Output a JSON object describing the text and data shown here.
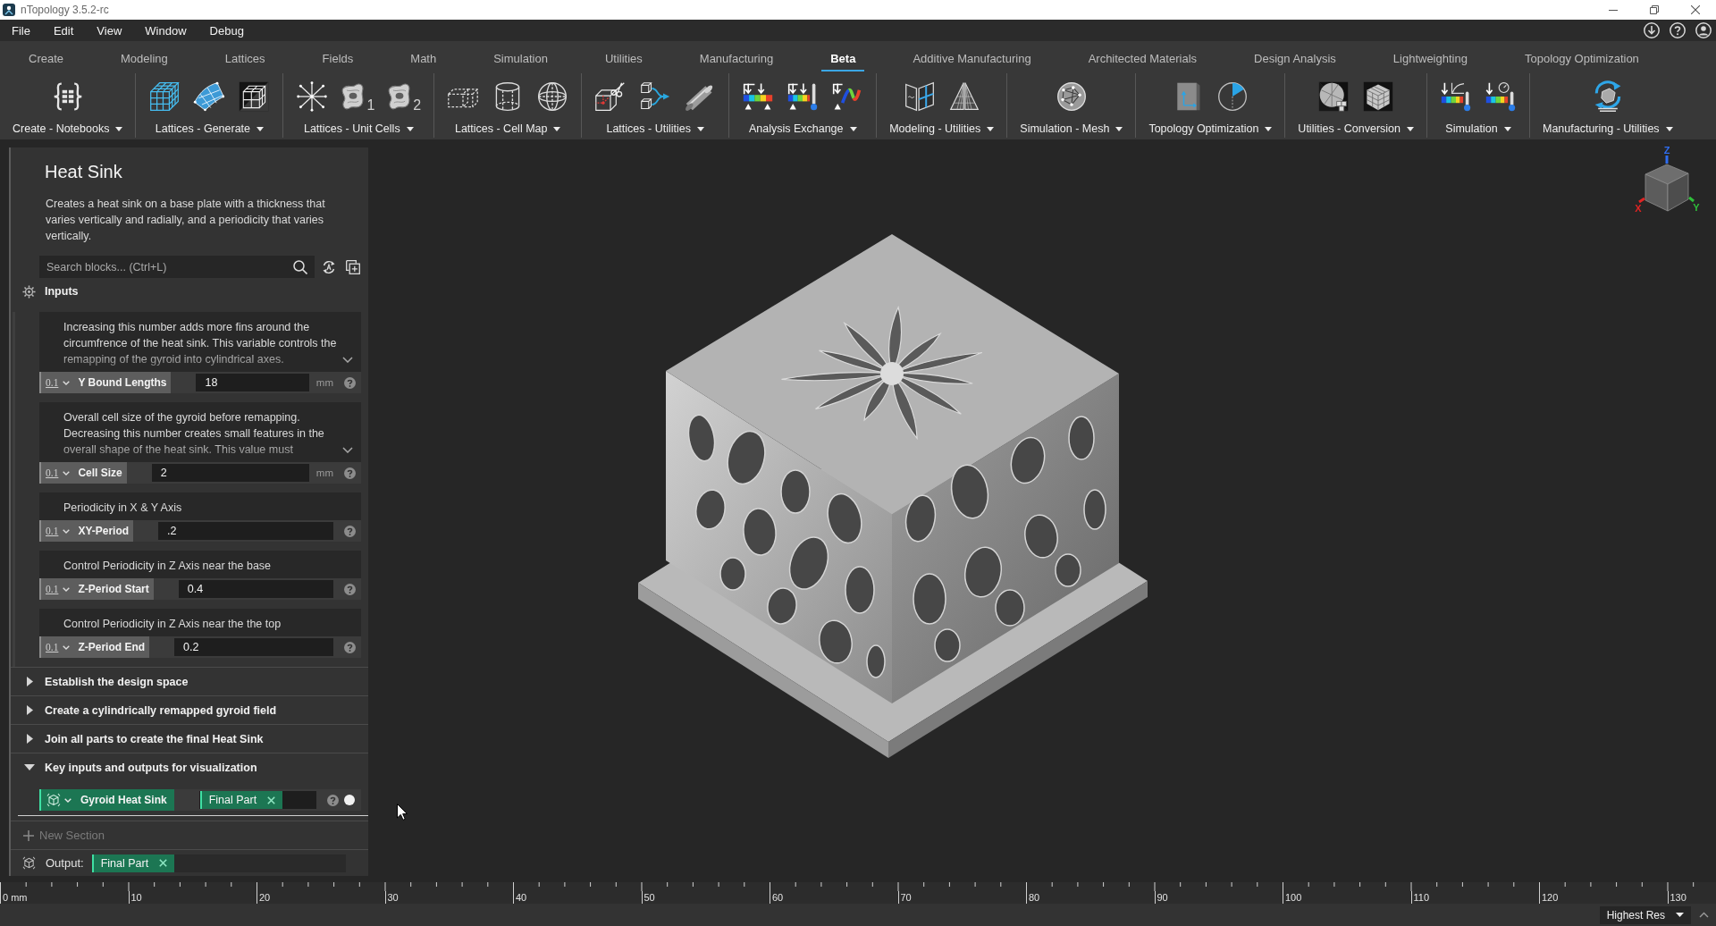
{
  "window": {
    "title": "nTopology 3.5.2-rc"
  },
  "menu": [
    "File",
    "Edit",
    "View",
    "Window",
    "Debug"
  ],
  "ribbon": {
    "tabs": [
      {
        "label": "Create",
        "selected": false
      },
      {
        "label": "Modeling",
        "selected": false
      },
      {
        "label": "Lattices",
        "selected": false
      },
      {
        "label": "Fields",
        "selected": false
      },
      {
        "label": "Math",
        "selected": false
      },
      {
        "label": "Simulation",
        "selected": false
      },
      {
        "label": "Utilities",
        "selected": false
      },
      {
        "label": "Manufacturing",
        "selected": false
      },
      {
        "label": "Beta",
        "selected": true
      },
      {
        "label": "Additive Manufacturing",
        "selected": false
      },
      {
        "label": "Architected Materials",
        "selected": false
      },
      {
        "label": "Design Analysis",
        "selected": false
      },
      {
        "label": "Lightweighting",
        "selected": false
      },
      {
        "label": "Topology Optimization",
        "selected": false
      }
    ],
    "groups": [
      {
        "label": "Create - Notebooks",
        "tools": [
          {
            "kind": "notebook"
          }
        ]
      },
      {
        "label": "Lattices - Generate",
        "tools": [
          {
            "kind": "grid-lattice"
          },
          {
            "kind": "surface-lattice"
          },
          {
            "kind": "volume-lattice"
          }
        ]
      },
      {
        "label": "Lattices - Unit Cells",
        "tools": [
          {
            "kind": "strut-cell"
          },
          {
            "kind": "gyroid-cell",
            "badge": "1"
          },
          {
            "kind": "gyroid-cell",
            "badge": "2"
          }
        ]
      },
      {
        "label": "Lattices - Cell Map",
        "tools": [
          {
            "kind": "box-map"
          },
          {
            "kind": "cylinder-map"
          },
          {
            "kind": "sphere-map"
          }
        ]
      },
      {
        "label": "Lattices - Utilities",
        "tools": [
          {
            "kind": "trim-cell"
          },
          {
            "kind": "merge-cells"
          },
          {
            "kind": "rod"
          }
        ]
      },
      {
        "label": "Analysis Exchange",
        "tools": [
          {
            "kind": "load-map"
          },
          {
            "kind": "thermal-load"
          },
          {
            "kind": "wave-load"
          }
        ]
      },
      {
        "label": "Modeling - Utilities",
        "tools": [
          {
            "kind": "image-panels"
          },
          {
            "kind": "split-pyramid"
          }
        ]
      },
      {
        "label": "Simulation - Mesh",
        "tools": [
          {
            "kind": "mesh-sphere"
          }
        ]
      },
      {
        "label": "Topology Optimization",
        "tools": [
          {
            "kind": "design-panel"
          },
          {
            "kind": "dial"
          }
        ]
      },
      {
        "label": "Utilities - Conversion",
        "tools": [
          {
            "kind": "sphere-voxel"
          },
          {
            "kind": "voxel-cube"
          }
        ]
      },
      {
        "label": "Simulation",
        "tools": [
          {
            "kind": "thermal-graph"
          },
          {
            "kind": "thermal-gauge"
          }
        ]
      },
      {
        "label": "Manufacturing - Utilities",
        "tools": [
          {
            "kind": "recycle-part"
          }
        ]
      }
    ]
  },
  "notebook": {
    "title": "Heat Sink",
    "description": "Creates a heat sink on a base plate with a thickness that varies vertically and radially, and a periodicity that varies vertically.",
    "search": {
      "placeholder": "Search blocks... (Ctrl+L)"
    },
    "inputs": {
      "title": "Inputs",
      "variables": [
        {
          "description": "Increasing this number adds more fins around the circumfrence of the heat sink. This variable controls the remapping of the gyroid into cylindrical axes.",
          "truncated": true,
          "precision": "0.1",
          "name": "Y Bound Lengths",
          "value": "18",
          "unit": "mm"
        },
        {
          "description": "Overall cell size of the gyroid before remapping. Decreasing this number creates small features in the overall shape of the heat sink. This value must",
          "truncated": true,
          "precision": "0.1",
          "name": "Cell Size",
          "value": "2",
          "unit": "mm"
        },
        {
          "description": "Periodicity in X & Y Axis",
          "truncated": false,
          "precision": "0.1",
          "name": "XY-Period",
          "value": ".2"
        },
        {
          "description": "Control Periodicity in Z Axis near the base",
          "truncated": false,
          "precision": "0.1",
          "name": "Z-Period Start",
          "value": "0.4"
        },
        {
          "description": "Control Periodicity in Z Axis near the the top",
          "truncated": false,
          "precision": "0.1",
          "name": "Z-Period End",
          "value": "0.2"
        }
      ]
    },
    "sections": [
      {
        "title": "Establish the design space",
        "expanded": false
      },
      {
        "title": "Create a cylindrically remapped gyroid field",
        "expanded": false
      },
      {
        "title": "Join all parts to create the final Heat Sink",
        "expanded": false
      },
      {
        "title": "Key inputs and outputs for visualization",
        "expanded": true,
        "outputs": [
          {
            "name": "Gyroid Heat Sink",
            "chip": "Final Part",
            "visible": true
          }
        ]
      }
    ],
    "new_section": "New Section",
    "output": {
      "label": "Output:",
      "chip": "Final Part"
    }
  },
  "viewport": {
    "axes": [
      {
        "label": "Z",
        "color": "#2f6df0"
      },
      {
        "label": "X",
        "color": "#e02424"
      },
      {
        "label": "Y",
        "color": "#2fbf3a"
      }
    ]
  },
  "ruler": {
    "labels": [
      "0 mm",
      "10",
      "20",
      "30",
      "40",
      "50",
      "60",
      "70",
      "80",
      "90",
      "100",
      "110",
      "120",
      "130"
    ]
  },
  "status_bar": {
    "resolution": "Highest Res"
  }
}
